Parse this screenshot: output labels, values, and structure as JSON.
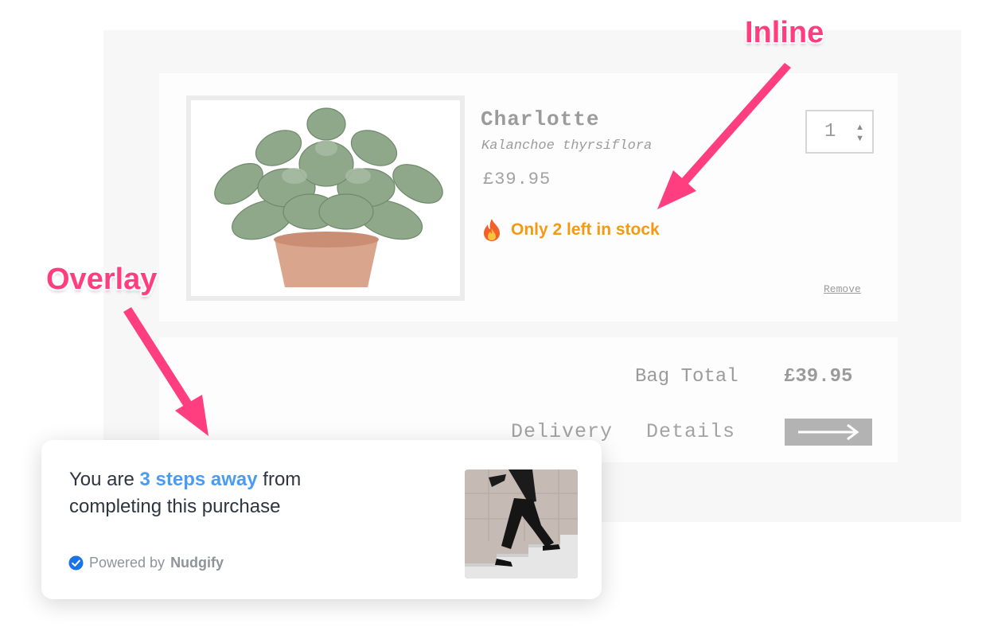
{
  "product": {
    "name": "Charlotte",
    "latin_name": "Kalanchoe thyrsiflora",
    "price": "£39.95",
    "stock_message": "Only 2 left in stock",
    "quantity": "1",
    "remove_label": "Remove"
  },
  "summary": {
    "bag_total_label": "Bag Total",
    "bag_total_value": "£39.95",
    "delivery_label": "Delivery",
    "details_label": "Details"
  },
  "annotations": {
    "inline": "Inline",
    "overlay": "Overlay"
  },
  "popup": {
    "prefix": "You are ",
    "highlight": "3 steps away",
    "suffix": " from completing this purchase",
    "powered_by": "Powered by",
    "brand": "Nudgify"
  },
  "icons": {
    "stock": "flame-icon",
    "next": "right-arrow-icon",
    "verified": "check-circle-icon"
  },
  "colors": {
    "annotation": "#ff3e7f",
    "stock": "#f39a12",
    "highlight": "#4b9cf0",
    "verified": "#1a73e8"
  }
}
